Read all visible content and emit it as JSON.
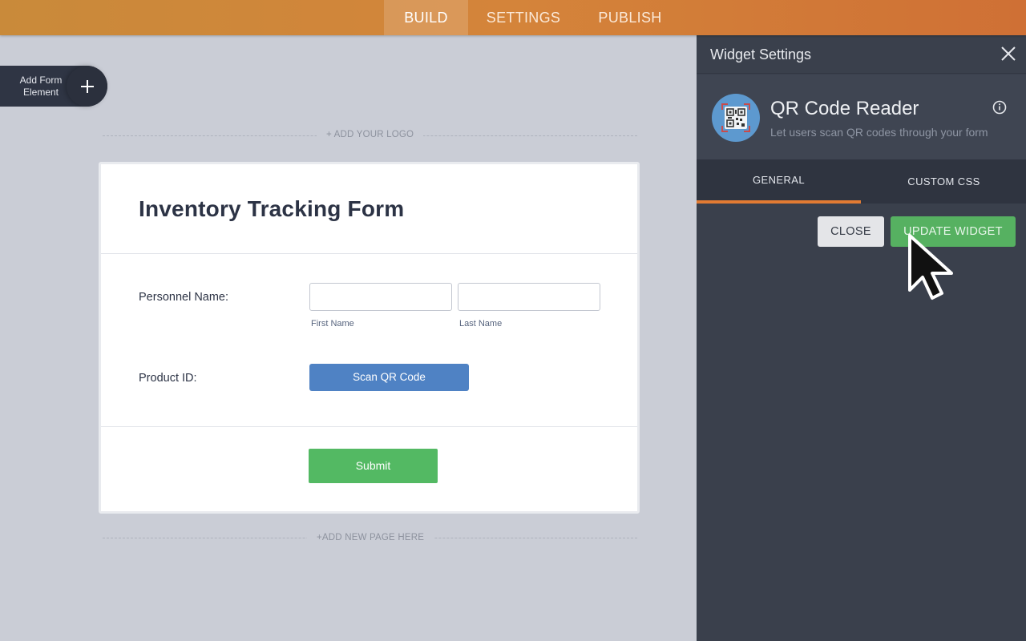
{
  "topbar": {
    "tabs": [
      {
        "label": "BUILD",
        "active": true
      },
      {
        "label": "SETTINGS",
        "active": false
      },
      {
        "label": "PUBLISH",
        "active": false
      }
    ],
    "gradient": [
      "#c98a3a",
      "#cf7035"
    ]
  },
  "builder": {
    "add_element_label": "Add Form Element",
    "add_logo_label": "+ ADD YOUR LOGO",
    "add_page_label": "+ADD NEW PAGE HERE"
  },
  "form": {
    "title": "Inventory Tracking Form",
    "personnel_label": "Personnel Name:",
    "first_name_sublabel": "First Name",
    "last_name_sublabel": "Last Name",
    "first_name_value": "",
    "last_name_value": "",
    "product_label": "Product ID:",
    "scan_button": "Scan QR Code",
    "submit_button": "Submit"
  },
  "panel": {
    "title": "Widget Settings",
    "widget_name": "QR Code Reader",
    "widget_description": "Let users scan QR codes through your form",
    "tabs": [
      {
        "label": "GENERAL",
        "active": true
      },
      {
        "label": "CUSTOM CSS",
        "active": false
      }
    ],
    "close_button": "CLOSE",
    "update_button": "UPDATE WIDGET",
    "accent_color": "#e27b33"
  }
}
